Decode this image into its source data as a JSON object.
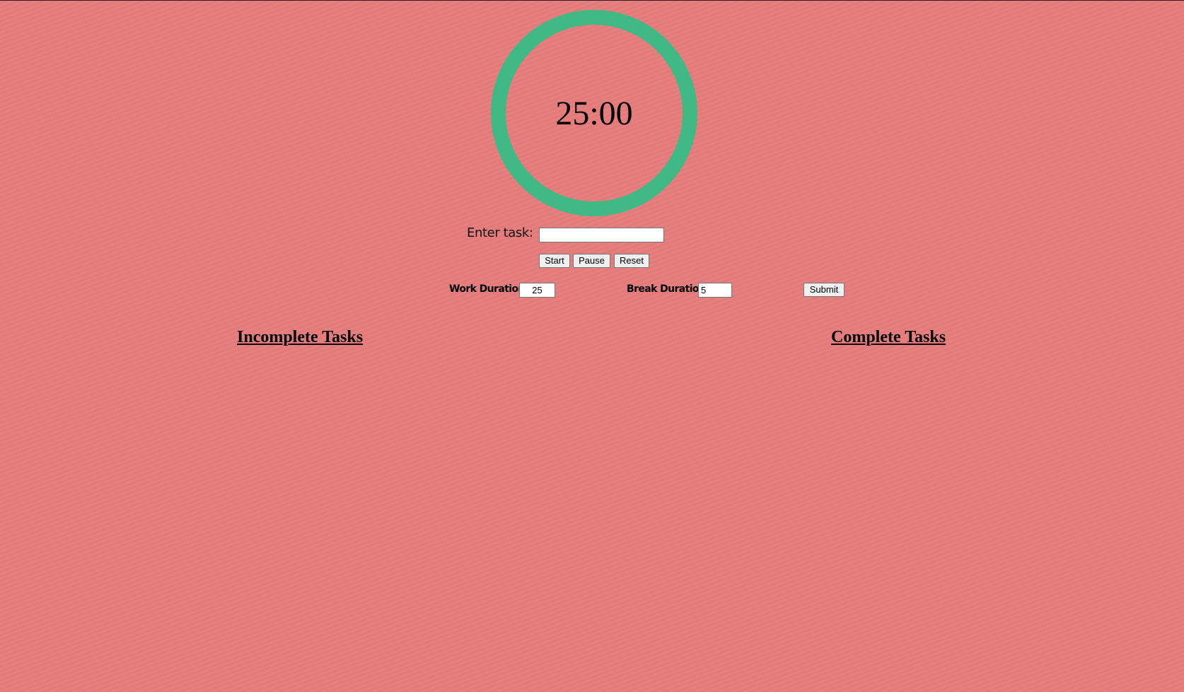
{
  "timer": {
    "display": "25:00",
    "ring_color": "#40b984"
  },
  "background_color": "#e67c7c",
  "task_entry": {
    "label": "Enter task:",
    "value": "",
    "placeholder": ""
  },
  "controls": {
    "start_label": "Start",
    "pause_label": "Pause",
    "reset_label": "Reset"
  },
  "durations": {
    "work_label": "Work Duration",
    "work_value": "25",
    "break_label": "Break Duration",
    "break_value": "5",
    "submit_label": "Submit"
  },
  "lists": {
    "incomplete_title": "Incomplete Tasks",
    "complete_title": "Complete Tasks"
  }
}
